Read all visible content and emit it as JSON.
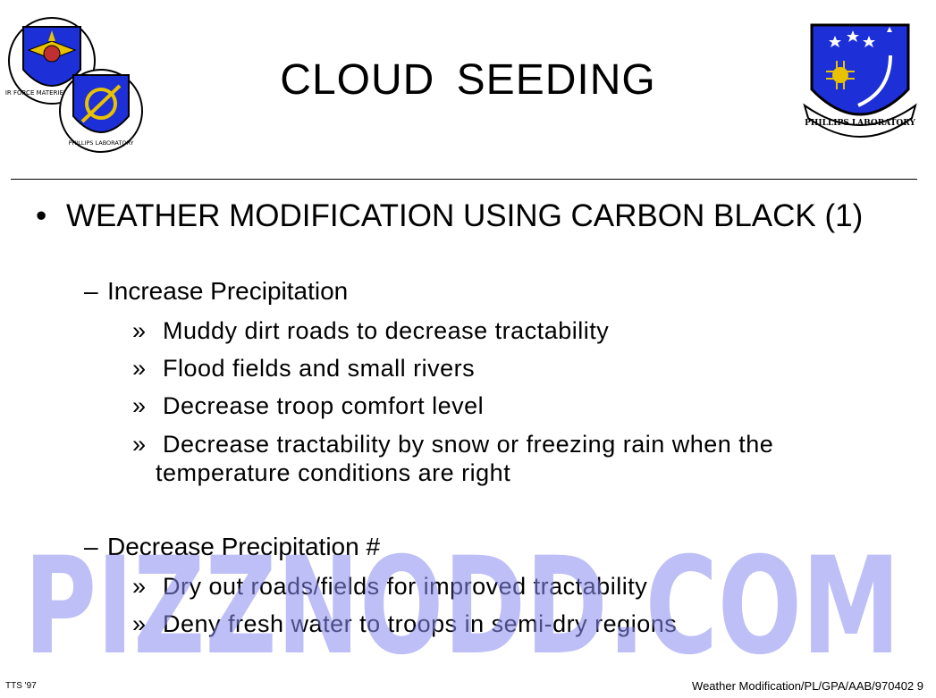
{
  "title": "CLOUD  SEEDING",
  "logos": {
    "afmc_ring_text": "AIR FORCE MATERIEL COMMAND",
    "pl_small_ring_text": "PHILLIPS LABORATORY",
    "phillips_banner": "PHILLIPS LABORATORY"
  },
  "bullet": {
    "glyph": "•",
    "text": "WEATHER MODIFICATION USING CARBON BLACK (1)"
  },
  "sections": [
    {
      "dash": "–",
      "heading": "Increase Precipitation",
      "items": [
        "Muddy dirt roads to decrease tractability",
        "Flood fields and small rivers",
        "Decrease troop comfort level",
        "Decrease tractability by snow or freezing rain when the"
      ],
      "continuation": "temperature conditions are right"
    },
    {
      "dash": "–",
      "heading": "Decrease Precipitation #",
      "items": [
        "Dry out roads/fields for improved tractability",
        "Deny fresh water to troops in semi-dry regions"
      ]
    }
  ],
  "sub_glyph": "»",
  "watermark": "PIZZNODD.COM",
  "footer": {
    "left": "TTS '97",
    "right": "Weather Modification/PL/GPA/AAB/970402  9"
  },
  "colors": {
    "shield_blue": "#1d2fd6",
    "gold": "#e8c200",
    "watermark": "#8a8cf0"
  }
}
